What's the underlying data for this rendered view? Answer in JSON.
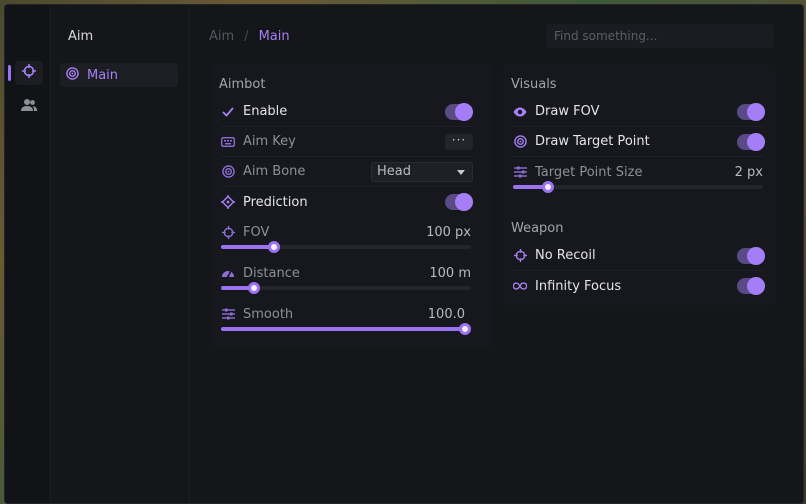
{
  "colors": {
    "accent": "#9b72f2",
    "toggle_track": "#5a4a86",
    "background": "#141519"
  },
  "rail": {
    "items": [
      {
        "icon": "crosshair-icon",
        "active": true
      },
      {
        "icon": "users-icon",
        "active": false
      }
    ]
  },
  "nav": {
    "title": "Aim",
    "items": [
      {
        "label": "Main",
        "icon": "target-icon",
        "active": true
      }
    ]
  },
  "breadcrumb": {
    "parent": "Aim",
    "separator": "/",
    "current": "Main"
  },
  "search": {
    "placeholder": "Find something..."
  },
  "aimbot": {
    "title": "Aimbot",
    "enable": {
      "label": "Enable",
      "icon": "check-icon",
      "value": true
    },
    "aim_key": {
      "label": "Aim Key",
      "icon": "keyboard-icon",
      "button": "···"
    },
    "aim_bone": {
      "label": "Aim Bone",
      "icon": "target-icon",
      "value": "Head"
    },
    "prediction": {
      "label": "Prediction",
      "icon": "crosshair-diamond-icon",
      "value": true
    },
    "fov": {
      "label": "FOV",
      "icon": "crosshair-icon",
      "value_text": "100 px",
      "fraction": 0.21
    },
    "distance": {
      "label": "Distance",
      "icon": "gauge-icon",
      "value_text": "100 m",
      "fraction": 0.13
    },
    "smooth": {
      "label": "Smooth",
      "icon": "sliders-icon",
      "value_text": "100.0",
      "fraction": 1.0
    }
  },
  "visuals": {
    "title": "Visuals",
    "draw_fov": {
      "label": "Draw FOV",
      "icon": "eye-icon",
      "value": true
    },
    "draw_target_point": {
      "label": "Draw Target Point",
      "icon": "target-icon",
      "value": true
    },
    "target_point_size": {
      "label": "Target Point Size",
      "icon": "sliders-icon",
      "value_text": "2 px",
      "fraction": 0.14
    }
  },
  "weapon": {
    "title": "Weapon",
    "no_recoil": {
      "label": "No Recoil",
      "icon": "crosshair-icon",
      "value": true
    },
    "infinity_focus": {
      "label": "Infinity Focus",
      "icon": "infinity-icon",
      "value": true
    }
  }
}
